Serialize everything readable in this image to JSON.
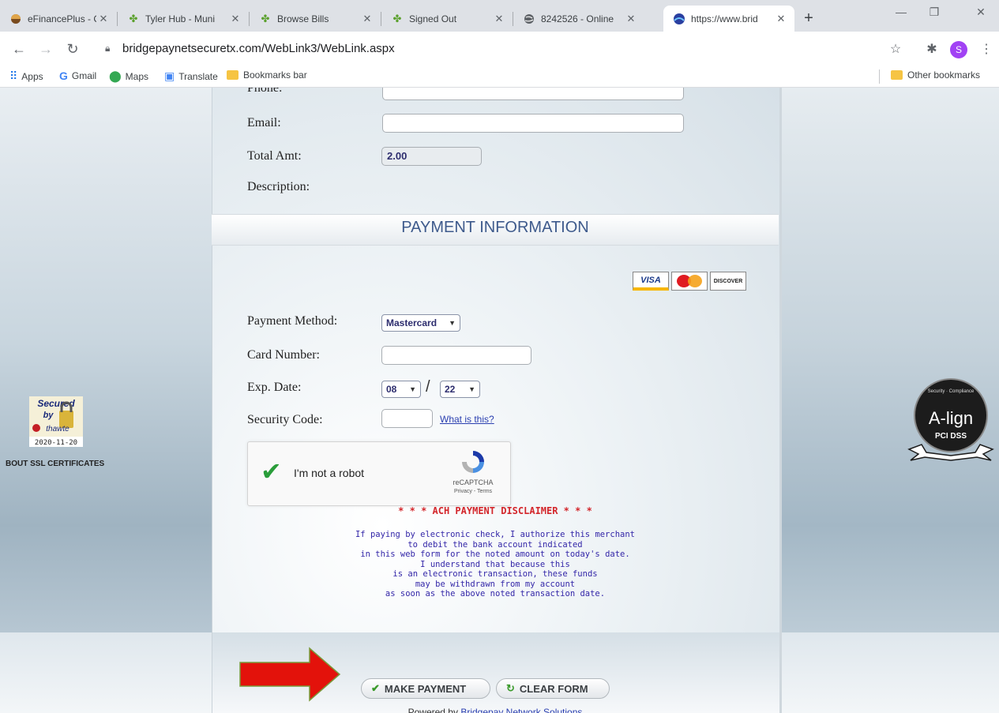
{
  "tabs": [
    {
      "title": "eFinancePlus - C",
      "icon": "efinance-icon"
    },
    {
      "title": "Tyler Hub - Muni",
      "icon": "tyler-icon"
    },
    {
      "title": "Browse Bills",
      "icon": "tyler-icon"
    },
    {
      "title": "Signed Out",
      "icon": "tyler-icon"
    },
    {
      "title": "8242526 - Online",
      "icon": "globe-icon"
    },
    {
      "title": "https://www.brid",
      "icon": "bridgepay-icon"
    }
  ],
  "toolbar": {
    "url": "bridgepaynetsecuretx.com/WebLink3/WebLink.aspx",
    "avatar_initial": "S"
  },
  "bookmarks": {
    "items": [
      "Apps",
      "Gmail",
      "Maps",
      "Translate",
      "Bookmarks bar"
    ],
    "other": "Other bookmarks"
  },
  "form": {
    "phone_label": "Phone:",
    "email_label": "Email:",
    "total_label": "Total Amt:",
    "total_value": "2.00",
    "description_label": "Description:"
  },
  "payment": {
    "section_title": "PAYMENT INFORMATION",
    "method_label": "Payment Method:",
    "method_value": "Mastercard",
    "card_number_label": "Card Number:",
    "exp_label": "Exp. Date:",
    "exp_month": "08",
    "exp_year": "22",
    "security_label": "Security Code:",
    "what_is_this": "What is this?",
    "cards": [
      "VISA",
      "MasterCard",
      "DISCOVER"
    ]
  },
  "captcha": {
    "label": "I'm not a robot",
    "brand": "reCAPTCHA",
    "links": "Privacy - Terms"
  },
  "disclaimer": {
    "title": "* * * ACH PAYMENT DISCLAIMER * * *",
    "lines": [
      "If paying by electronic check, I authorize this merchant",
      "to debit the bank account indicated",
      "in this web form for the noted amount on today's date.",
      "I understand that because this",
      "is an electronic transaction, these funds",
      "may be withdrawn from my account",
      "as soon as the above noted transaction date."
    ]
  },
  "buttons": {
    "make_payment": "MAKE PAYMENT",
    "clear_form": "CLEAR FORM"
  },
  "footer": {
    "powered_prefix": "Powered by ",
    "powered_link": "Bridgepay Network Solutions"
  },
  "seals": {
    "left_secured": "Secured",
    "left_by": "by",
    "left_brand": "thawte",
    "left_date": "2020-11-20",
    "left_caption": "BOUT SSL CERTIFICATES",
    "right_brand": "A-lign",
    "right_sub": "PCI DSS",
    "right_ribbon": "Security · Compliance"
  },
  "colors": {
    "section_title": "#3e5a8c",
    "disclaimer_title": "#d3262b",
    "disclaimer_body": "#3326a8",
    "arrow": "#e3120b"
  }
}
